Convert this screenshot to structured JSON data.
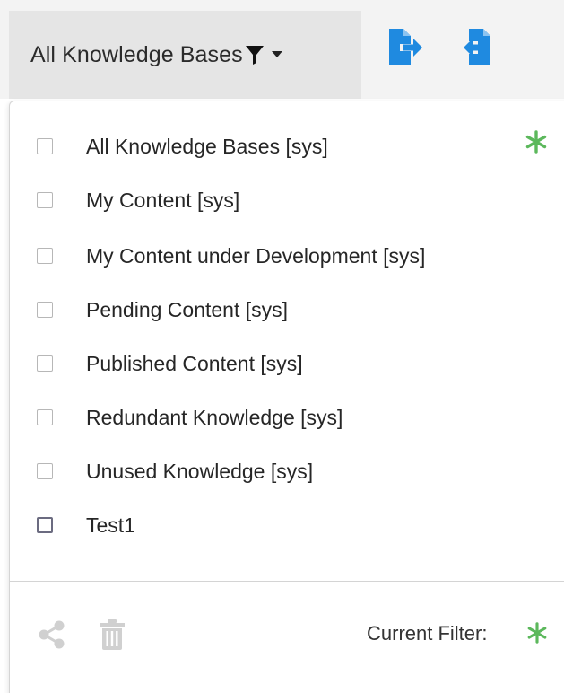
{
  "toolbar": {
    "filter_label": "All Knowledge Bases",
    "filter_icon": "funnel-icon",
    "export_icon": "file-export-icon",
    "import_icon": "file-import-icon"
  },
  "filters": [
    {
      "label": "All Knowledge Bases  [sys]",
      "checked": false,
      "active": true
    },
    {
      "label": "My Content  [sys]",
      "checked": false
    },
    {
      "label": "My Content under Development  [sys]",
      "checked": false
    },
    {
      "label": "Pending Content  [sys]",
      "checked": false
    },
    {
      "label": "Published Content  [sys]",
      "checked": false
    },
    {
      "label": "Redundant Knowledge  [sys]",
      "checked": false
    },
    {
      "label": "Unused Knowledge  [sys]",
      "checked": false
    },
    {
      "label": "Test1",
      "checked": false
    }
  ],
  "footer": {
    "current_filter_label": "Current Filter:",
    "share_icon": "share-icon",
    "delete_icon": "trash-icon"
  },
  "colors": {
    "accent_blue": "#1f8ae0",
    "active_green": "#5cb85c",
    "disabled_gray": "#d0d0d0"
  }
}
